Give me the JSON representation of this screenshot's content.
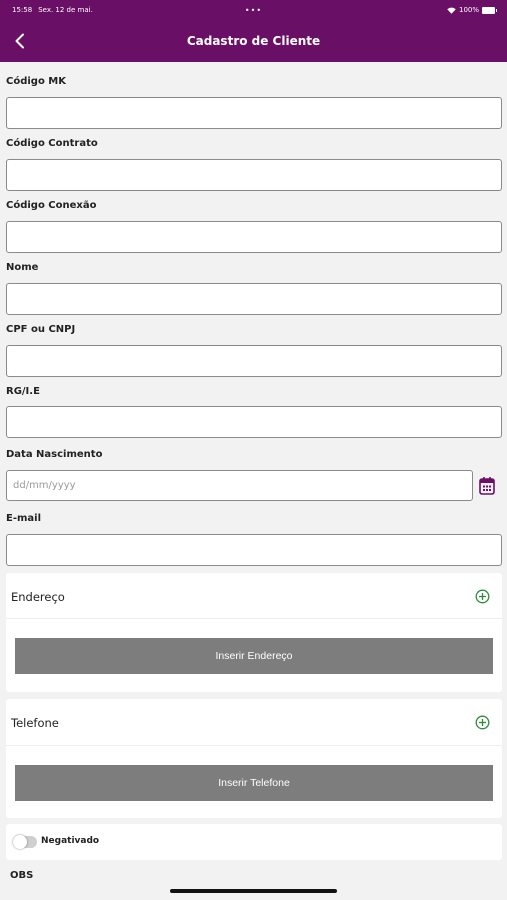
{
  "status_bar": {
    "time": "15:58",
    "date": "Sex. 12 de mai.",
    "center_dots": "•••",
    "battery": "100%"
  },
  "navbar": {
    "title": "Cadastro de Cliente",
    "back_icon": "chevron-left-icon"
  },
  "form": {
    "codigo_mk": {
      "label": "Código MK",
      "value": ""
    },
    "codigo_contrato": {
      "label": "Código Contrato",
      "value": ""
    },
    "codigo_conexao": {
      "label": "Código Conexão",
      "value": ""
    },
    "nome": {
      "label": "Nome",
      "value": ""
    },
    "cpf_cnpj": {
      "label": "CPF ou CNPJ",
      "value": ""
    },
    "rg_ie": {
      "label": "RG/I.E",
      "value": ""
    },
    "data_nascimento": {
      "label": "Data Nascimento",
      "value": "",
      "placeholder": "dd/mm/yyyy",
      "icon": "calendar-icon"
    },
    "email": {
      "label": "E-mail",
      "value": ""
    }
  },
  "endereco": {
    "title": "Endereço",
    "add_icon": "plus-circle-icon",
    "button_label": "Inserir Endereço"
  },
  "telefone": {
    "title": "Telefone",
    "add_icon": "plus-circle-icon",
    "button_label": "Inserir Telefone"
  },
  "negativado": {
    "label": "Negativado",
    "checked": false
  },
  "obs": {
    "label": "OBS"
  },
  "colors": {
    "header": "#6a0f66",
    "button_gray": "#7d7d7d",
    "accent_green": "#2e8b3a",
    "calendar_purple": "#6a0f66",
    "background": "#f2f2f2"
  }
}
